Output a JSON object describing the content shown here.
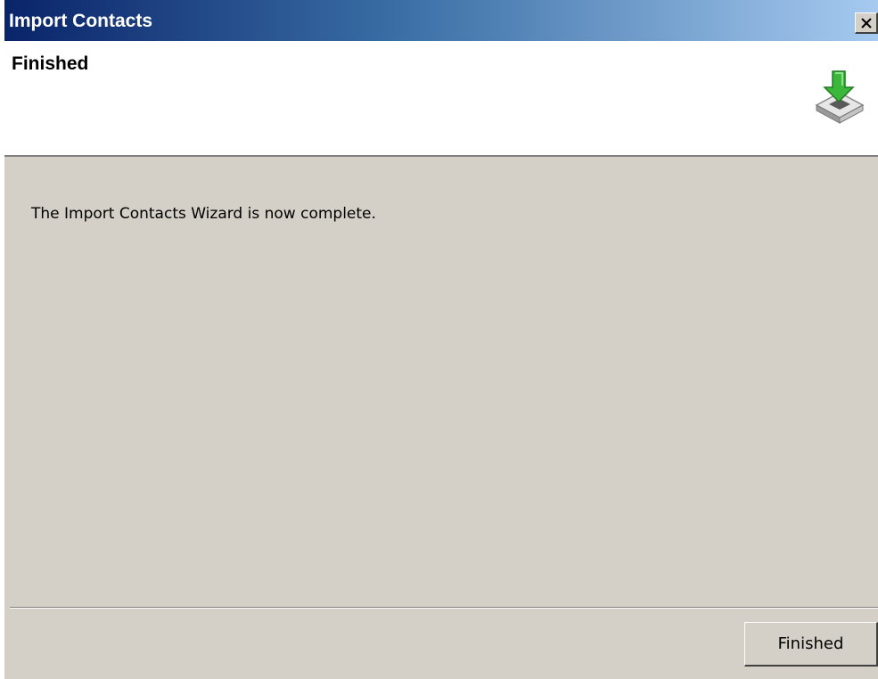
{
  "window": {
    "title": "Import Contacts",
    "close_icon": "close-icon"
  },
  "header": {
    "heading": "Finished",
    "icon": "download-tray-icon"
  },
  "body": {
    "message": "The Import Contacts Wizard is now complete."
  },
  "footer": {
    "finish_label": "Finished"
  },
  "colors": {
    "titlebar_start": "#0a246a",
    "titlebar_end": "#a6caf0",
    "dialog_background": "#d4d0c8",
    "header_background": "#ffffff",
    "icon_arrow": "#3bb83b"
  }
}
